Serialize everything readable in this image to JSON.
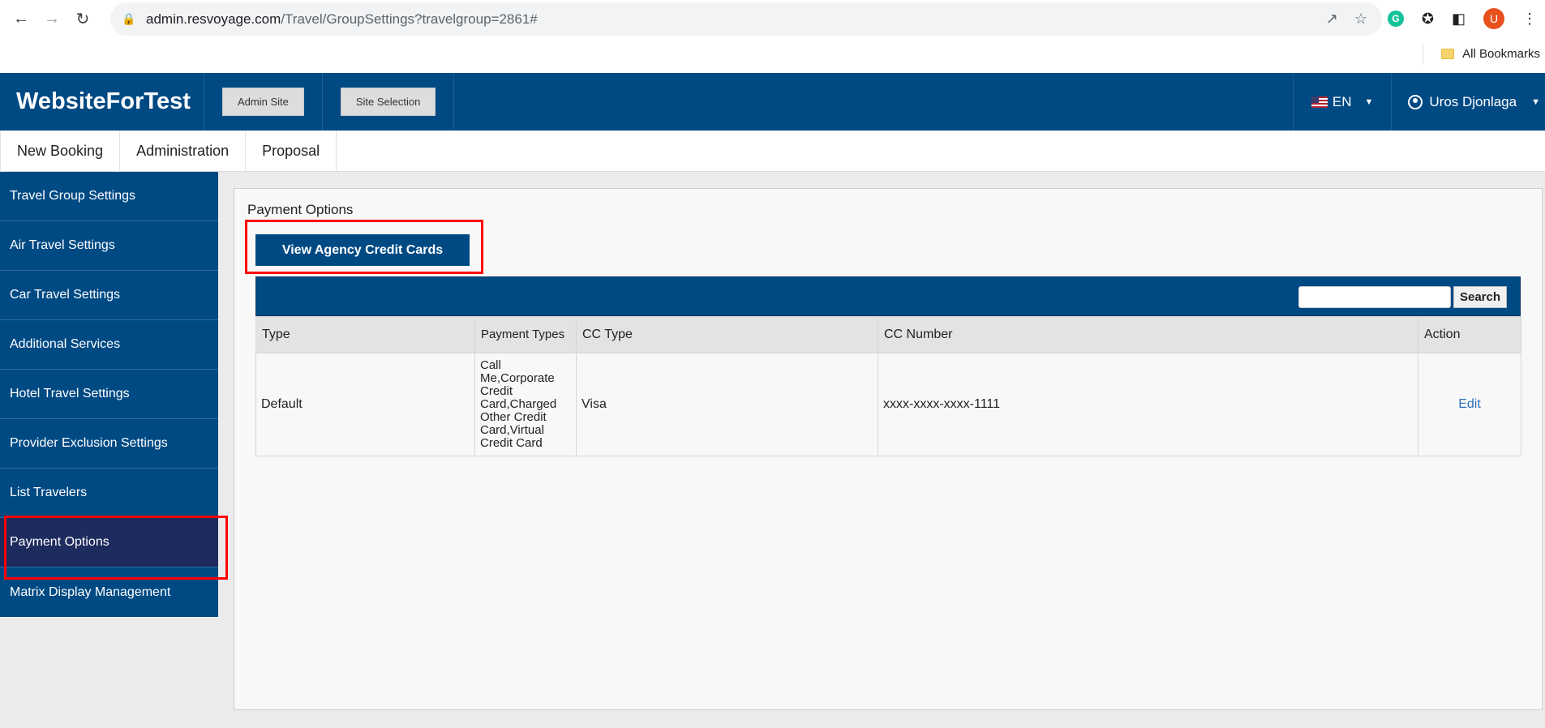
{
  "browser": {
    "url_domain": "admin.resvoyage.com",
    "url_path": "/Travel/GroupSettings?travelgroup=2861#",
    "profile_initial": "U",
    "all_bookmarks": "All Bookmarks"
  },
  "header": {
    "brand": "WebsiteForTest",
    "admin_site": "Admin Site",
    "site_selection": "Site Selection",
    "language": "EN",
    "user_name": "Uros Djonlaga"
  },
  "top_menu": [
    "New Booking",
    "Administration",
    "Proposal"
  ],
  "sidebar": {
    "items": [
      "Travel Group Settings",
      "Air Travel Settings",
      "Car Travel Settings",
      "Additional Services",
      "Hotel Travel Settings",
      "Provider Exclusion Settings",
      "List Travelers",
      "Payment Options",
      "Matrix Display Management"
    ],
    "active": "Payment Options"
  },
  "main": {
    "title": "Payment Options",
    "view_button": "View Agency Credit Cards",
    "search_placeholder": "",
    "search_button": "Search",
    "table": {
      "headers": [
        "Type",
        "Payment Types",
        "CC Type",
        "CC Number",
        "Action"
      ],
      "rows": [
        {
          "type": "Default",
          "payment_types": "Call Me,Corporate Credit Card,Charged Other Credit Card,Virtual Credit Card",
          "cc_type": "Visa",
          "cc_number": "xxxx-xxxx-xxxx-1111",
          "action": "Edit"
        }
      ]
    }
  },
  "colors": {
    "primary": "#004a84",
    "active_sidebar": "#1e2b5e",
    "highlight": "#ff0000",
    "link": "#2e6fb4"
  }
}
